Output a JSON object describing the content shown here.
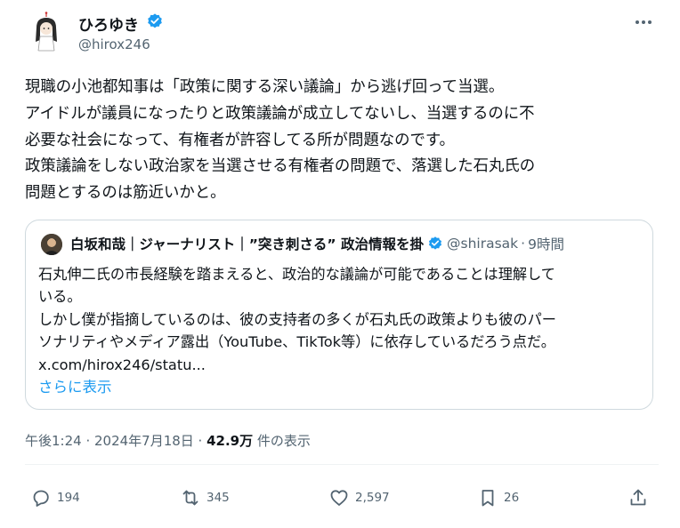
{
  "author": {
    "display_name": "ひろゆき",
    "handle": "@hirox246",
    "avatar_icon": "cartoon-avatar-icon",
    "verified_color": "#1d9bf0"
  },
  "post": {
    "lines": [
      "現職の小池都知事は「政策に関する深い議論」から逃げ回って当選。",
      "アイドルが議員になったりと政策議論が成立してないし、当選するのに不",
      "必要な社会になって、有権者が許容してる所が問題なのです。",
      "政策議論をしない政治家を当選させる有権者の問題で、落選した石丸氏の",
      "問題とするのは筋近いかと。"
    ]
  },
  "quote": {
    "name": "白坂和哉｜ジャーナリスト｜”突き刺さる” 政治情報を掛",
    "handle": "@shirasak",
    "separator": "·",
    "time": "9時間",
    "lines": [
      "石丸伸二氏の市長経験を踏まえると、政治的な議論が可能であることは理解して",
      "いる。",
      "しかし僕が指摘しているのは、彼の支持者の多くが石丸氏の政策よりも彼のパー",
      "ソナリティやメディア露出（YouTube、TikTok等）に依存しているだろう点だ。",
      "x.com/hirox246/statu..."
    ],
    "show_more": "さらに表示"
  },
  "meta": {
    "datetime": "午後1:24 · 2024年7月18日 · ",
    "views_count": "42.9万",
    "views_label": " 件の表示"
  },
  "actions": {
    "replies": "194",
    "reposts": "345",
    "likes": "2,597",
    "bookmarks": "26"
  },
  "colors": {
    "text": "#0f1419",
    "secondary": "#536471",
    "link": "#1d9bf0",
    "border": "#cfd9de"
  }
}
